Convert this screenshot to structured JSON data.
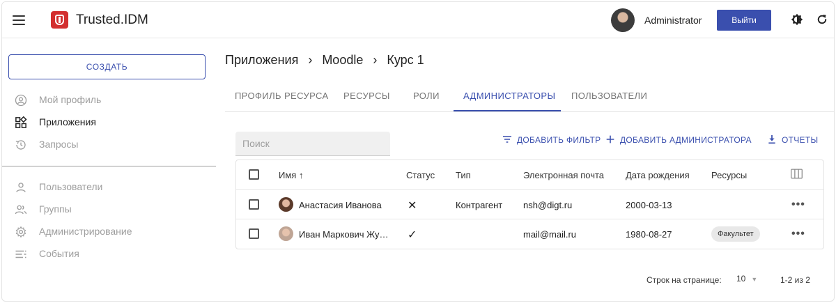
{
  "header": {
    "app_title": "Trusted.IDM",
    "user_name": "Administrator",
    "logout_label": "Выйти"
  },
  "sidebar": {
    "create_label": "СОЗДАТЬ",
    "items_top": [
      {
        "label": "Мой профиль",
        "icon": "user-circle-icon"
      },
      {
        "label": "Приложения",
        "icon": "apps-icon"
      },
      {
        "label": "Запросы",
        "icon": "history-icon"
      }
    ],
    "items_bottom": [
      {
        "label": "Пользователи",
        "icon": "user-icon"
      },
      {
        "label": "Группы",
        "icon": "group-icon"
      },
      {
        "label": "Администрирование",
        "icon": "gear-icon"
      },
      {
        "label": "События",
        "icon": "list-icon"
      }
    ]
  },
  "breadcrumb": [
    "Приложения",
    "Moodle",
    "Курс 1"
  ],
  "tabs": [
    "ПРОФИЛЬ РЕСУРСА",
    "РЕСУРСЫ",
    "РОЛИ",
    "АДМИНИСТРАТОРЫ",
    "ПОЛЬЗОВАТЕЛИ"
  ],
  "active_tab": "АДМИНИСТРАТОРЫ",
  "search": {
    "placeholder": "Поиск",
    "value": ""
  },
  "actions": {
    "add_filter": "ДОБАВИТЬ ФИЛЬТР",
    "add_admin": "ДОБАВИТЬ АДМИНИСТРАТОРА",
    "reports": "ОТЧЕТЫ"
  },
  "table": {
    "columns": [
      "Имя",
      "Статус",
      "Тип",
      "Электронная почта",
      "Дата рождения",
      "Ресурсы"
    ],
    "rows": [
      {
        "name": "Анастасия Иванова",
        "status": "✕",
        "type": "Контрагент",
        "email": "nsh@digt.ru",
        "birthdate": "2000-03-13",
        "resource": ""
      },
      {
        "name": "Иван Маркович Жу…",
        "status": "✓",
        "type": "",
        "email": "mail@mail.ru",
        "birthdate": "1980-08-27",
        "resource": "Факультет"
      }
    ]
  },
  "pagination": {
    "rows_label": "Строк на странице:",
    "rows_value": "10",
    "range": "1-2 из 2"
  },
  "colors": {
    "accent": "#3a4fae",
    "brand": "#d32f2f"
  }
}
